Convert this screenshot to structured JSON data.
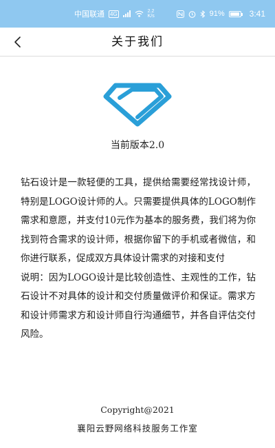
{
  "status_bar": {
    "carrier": "中国联通",
    "network": "4G",
    "speed": "2.2 K/s",
    "battery_text": "91%",
    "battery_level": 0.91,
    "time": "3:41"
  },
  "header": {
    "back_icon": "chevron-left-icon",
    "title": "关于我们"
  },
  "logo": {
    "icon": "diamond-logo-icon",
    "color": "#2a9fd8"
  },
  "version": "当前版本2.0",
  "content": {
    "paragraph_1": "钻石设计是一款轻便的工具，提供给需要经常找设计师，特别是LOGO设计师的人。只需要提供具体的LOGO制作需求和意愿，并支付10元作为基本的服务费，我们将为你找到符合需求的设计师，根据你留下的手机或者微信，和你进行联系，促成双方具体设计需求的对接和支付",
    "paragraph_2": "说明：因为LOGO设计是比较创造性、主观性的工作，钻石设计不对具体的设计和交付质量做评价和保证。需求方和设计师需求方和设计师自行沟通细节，并各自评估交付风险。"
  },
  "footer": {
    "copyright": "Copyright@2021",
    "company": "襄阳云野网络科技服务工作室"
  }
}
